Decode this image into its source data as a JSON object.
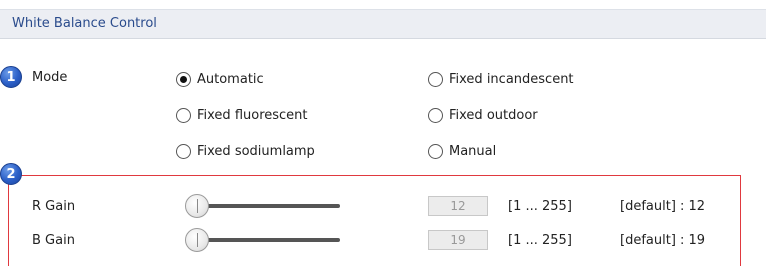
{
  "header": {
    "title": "White Balance Control"
  },
  "badges": {
    "mode": "1",
    "gain": "2"
  },
  "mode": {
    "label": "Mode",
    "selected": "Automatic",
    "options": [
      {
        "label": "Automatic",
        "checked": true
      },
      {
        "label": "Fixed incandescent",
        "checked": false
      },
      {
        "label": "Fixed fluorescent",
        "checked": false
      },
      {
        "label": "Fixed outdoor",
        "checked": false
      },
      {
        "label": "Fixed sodiumlamp",
        "checked": false
      },
      {
        "label": "Manual",
        "checked": false
      }
    ]
  },
  "gains": [
    {
      "label": "R Gain",
      "value": "12",
      "range": "[1 ... 255]",
      "default": "[default] : 12"
    },
    {
      "label": "B Gain",
      "value": "19",
      "range": "[1 ... 255]",
      "default": "[default] : 19"
    }
  ]
}
